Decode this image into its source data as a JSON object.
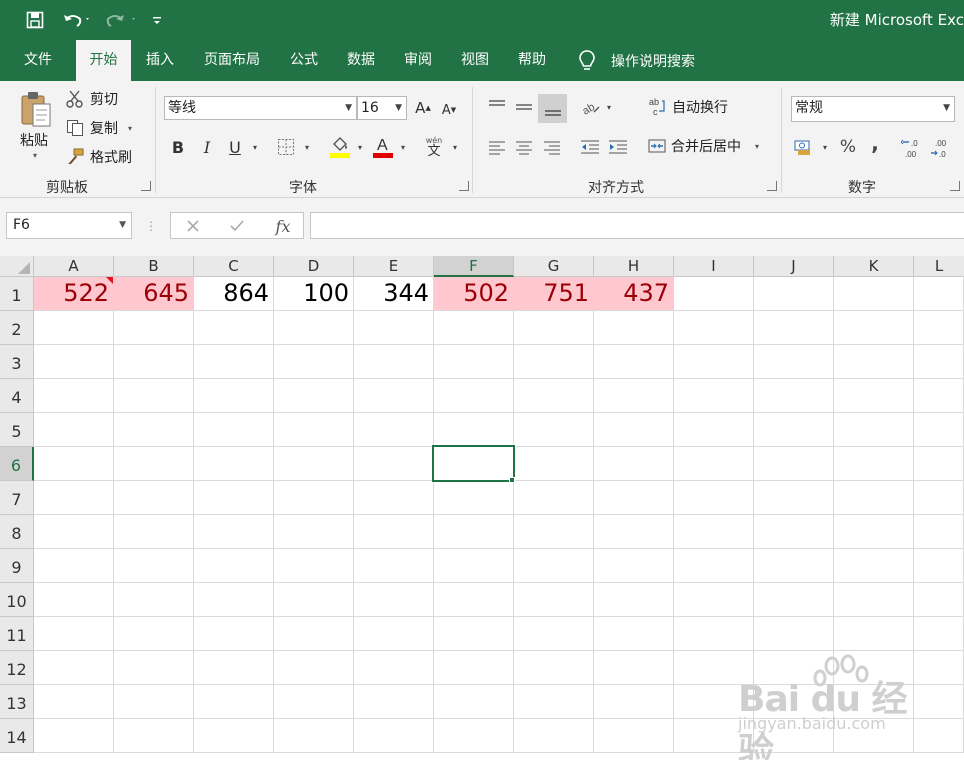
{
  "titlebar": {
    "title": "新建 Microsoft Exc",
    "qat_icons": [
      "save-icon",
      "undo-icon",
      "redo-icon",
      "customize-qat-icon"
    ]
  },
  "tabs": [
    "文件",
    "开始",
    "插入",
    "页面布局",
    "公式",
    "数据",
    "审阅",
    "视图",
    "帮助"
  ],
  "active_tab": "开始",
  "tell_me": "操作说明搜索",
  "ribbon": {
    "clipboard": {
      "paste": "粘贴",
      "cut": "剪切",
      "copy": "复制",
      "format_painter": "格式刷",
      "label": "剪贴板"
    },
    "font": {
      "font_name": "等线",
      "font_size": "16",
      "label": "字体",
      "bold": "B",
      "italic": "I",
      "underline": "U",
      "font_color_icon": "A",
      "phonetic": "wén\n文"
    },
    "alignment": {
      "wrap_text": "自动换行",
      "merge_center": "合并后居中",
      "label": "对齐方式"
    },
    "number": {
      "format": "常规",
      "label": "数字",
      "percent": "%",
      "comma": ","
    }
  },
  "formula_bar": {
    "name_box": "F6",
    "fx": "fx",
    "formula": ""
  },
  "columns": [
    "A",
    "B",
    "C",
    "D",
    "E",
    "F",
    "G",
    "H",
    "I",
    "J",
    "K",
    "L"
  ],
  "selected_column": "F",
  "rows": [
    "1",
    "2",
    "3",
    "4",
    "5",
    "6",
    "7",
    "8",
    "9",
    "10",
    "11",
    "12",
    "13",
    "14"
  ],
  "selected_row": "6",
  "row1_values": [
    "522",
    "645",
    "864",
    "100",
    "344",
    "502",
    "751",
    "437"
  ],
  "highlight_color": "#ffc7ce",
  "highlight_text_color": "#9c0006",
  "accent": "#217346",
  "watermark": {
    "main": "Bai du 经验",
    "sub": "jingyan.baidu.com"
  }
}
